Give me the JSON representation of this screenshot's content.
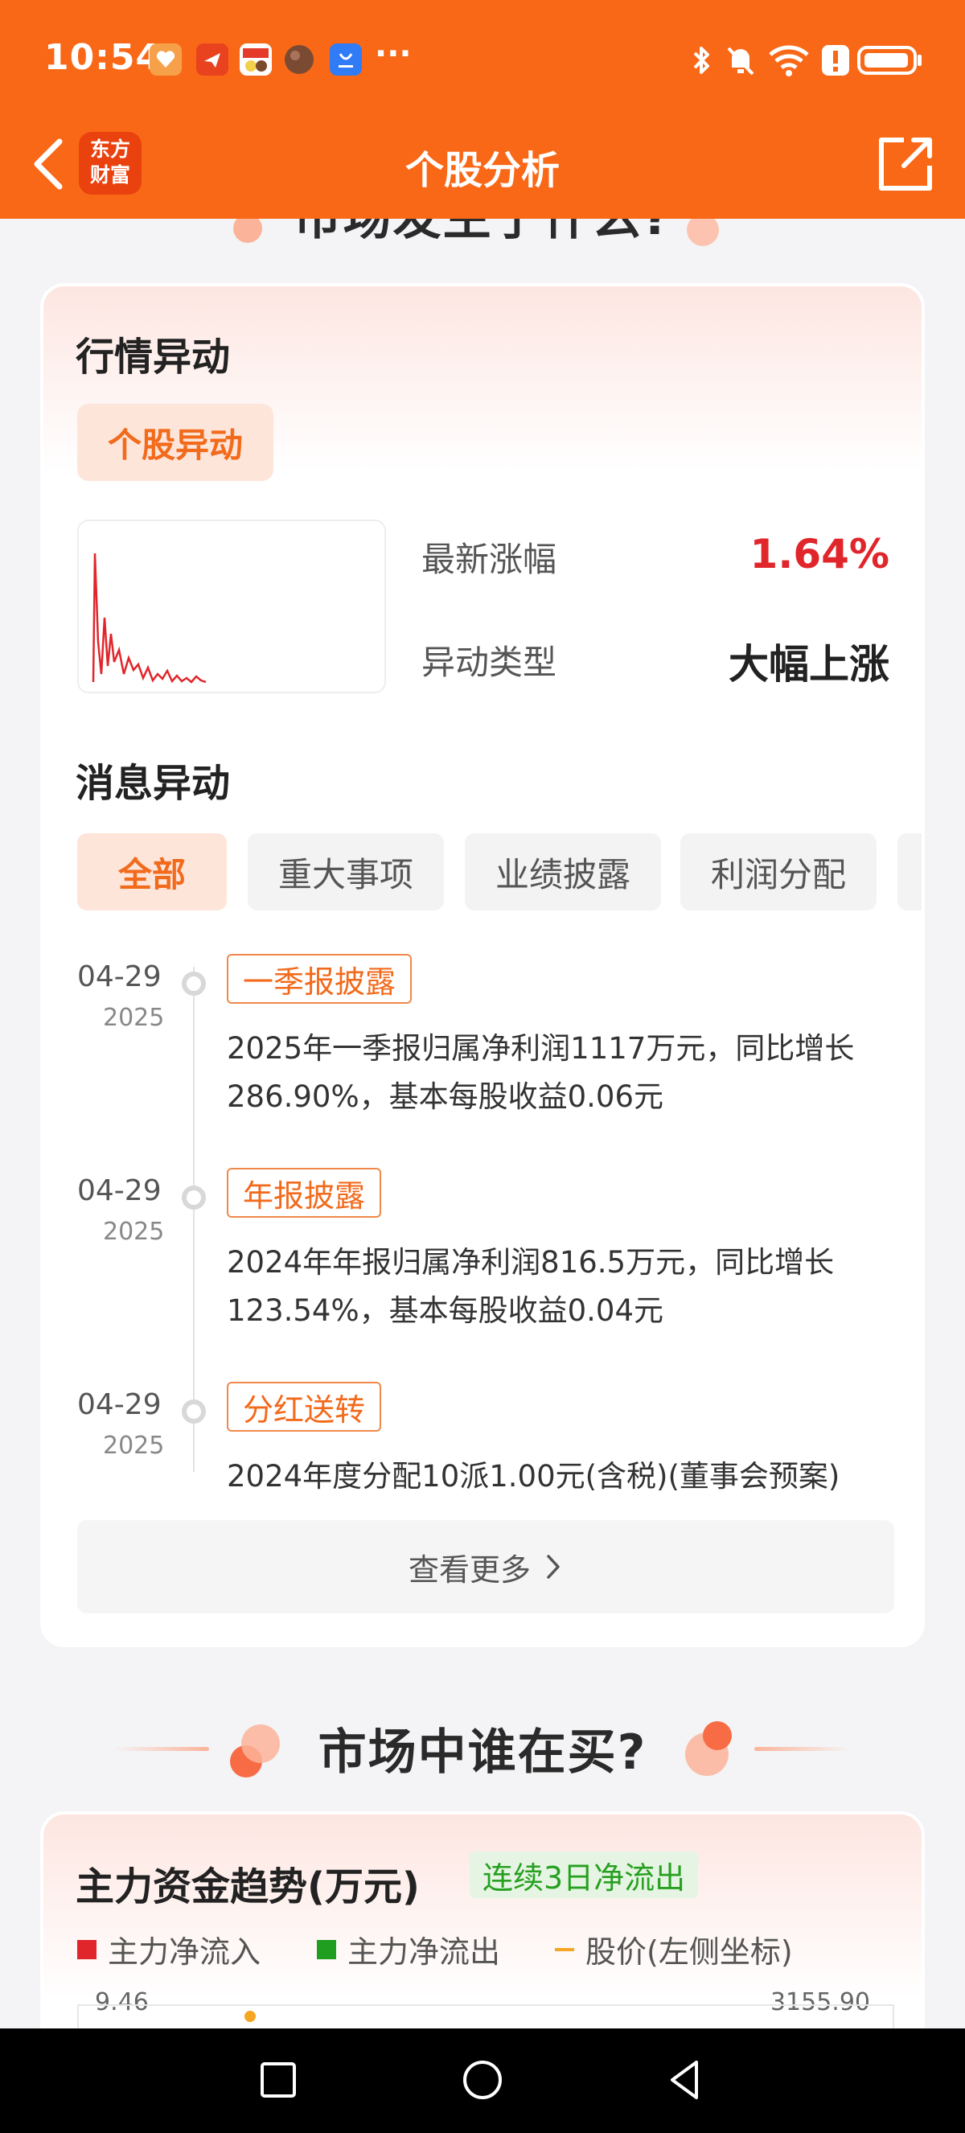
{
  "status_bar": {
    "time": "10:54",
    "more": "···",
    "notification_icons": [
      "health-app-icon",
      "mail-app-icon",
      "game-app-icon",
      "circle-app-icon",
      "store-app-icon"
    ],
    "system_icons": [
      "bluetooth-icon",
      "mute-icon",
      "wifi-icon",
      "alert-icon",
      "battery-icon"
    ]
  },
  "header": {
    "title": "个股分析",
    "logo_line1": "东方",
    "logo_line2": "财富",
    "accent_color": "#f96817"
  },
  "section_top": {
    "title": "市场发生了什么?"
  },
  "market_card": {
    "title": "行情异动",
    "tag": "个股异动",
    "metrics": [
      {
        "label": "最新涨幅",
        "value": "1.64%",
        "color": "#e0262b"
      },
      {
        "label": "异动类型",
        "value": "大幅上涨",
        "color": "#222222"
      }
    ],
    "news_title": "消息异动",
    "tabs": [
      "全部",
      "重大事项",
      "业绩披露",
      "利润分配"
    ],
    "timeline": [
      {
        "date": "04-29",
        "year": "2025",
        "tag": "一季报披露",
        "text": "2025年一季报归属净利润1117万元，同比增长286.90%，基本每股收益0.06元"
      },
      {
        "date": "04-29",
        "year": "2025",
        "tag": "年报披露",
        "text": "2024年年报归属净利润816.5万元，同比增长123.54%，基本每股收益0.04元"
      },
      {
        "date": "04-29",
        "year": "2025",
        "tag": "分红送转",
        "text": "2024年度分配10派1.00元(含税)(董事会预案)"
      }
    ],
    "more_label": "查看更多"
  },
  "section_who": {
    "title": "市场中谁在买?"
  },
  "fund_card": {
    "title": "主力资金趋势(万元)",
    "badge": "连续3日净流出",
    "legend": [
      {
        "label": "主力净流入",
        "color": "#e0262b"
      },
      {
        "label": "主力净流出",
        "color": "#1f9e1f"
      },
      {
        "label": "股价(左侧坐标)",
        "color": "#f5a623"
      }
    ],
    "axis_left_top": "9.46",
    "axis_right_top": "3155.90"
  },
  "nav_bar": {
    "buttons": [
      "recents-button",
      "home-button",
      "back-button"
    ]
  }
}
